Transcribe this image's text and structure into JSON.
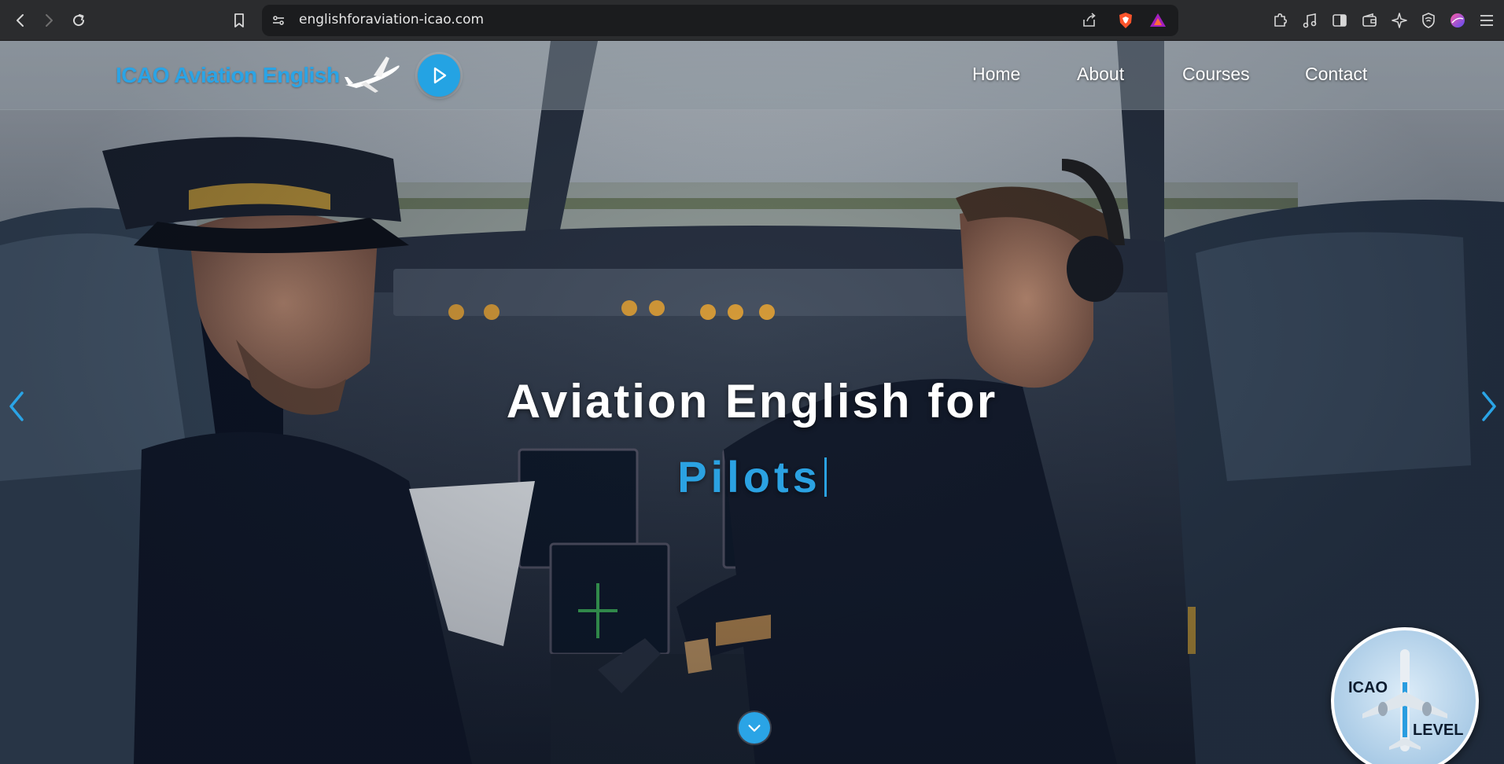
{
  "browser": {
    "url": "englishforaviation-icao.com",
    "nav_icons": [
      "back-icon",
      "forward-icon",
      "reload-icon",
      "bookmark-icon",
      "site-info-icon"
    ],
    "toolbar_icons": [
      "share-icon",
      "brave-shield-icon",
      "brave-rewards-icon",
      "extensions-icon",
      "media-icon",
      "sidebar-icon",
      "wallet-icon",
      "leo-ai-icon",
      "vpn-icon",
      "profile-icon",
      "menu-icon"
    ]
  },
  "header": {
    "logo_text": "ICAO Aviation English",
    "nav": [
      {
        "label": "Home"
      },
      {
        "label": "About"
      },
      {
        "label": "Courses"
      },
      {
        "label": "Contact"
      }
    ]
  },
  "hero": {
    "headline": "Aviation English for",
    "typed_word": "Pilots"
  },
  "badge": {
    "top_text": "ICAO",
    "bottom_text": "LEVEL"
  },
  "colors": {
    "accent": "#2aa4e6",
    "chrome_bg": "#2b2c2e",
    "urlbar_bg": "#1b1c1e"
  }
}
